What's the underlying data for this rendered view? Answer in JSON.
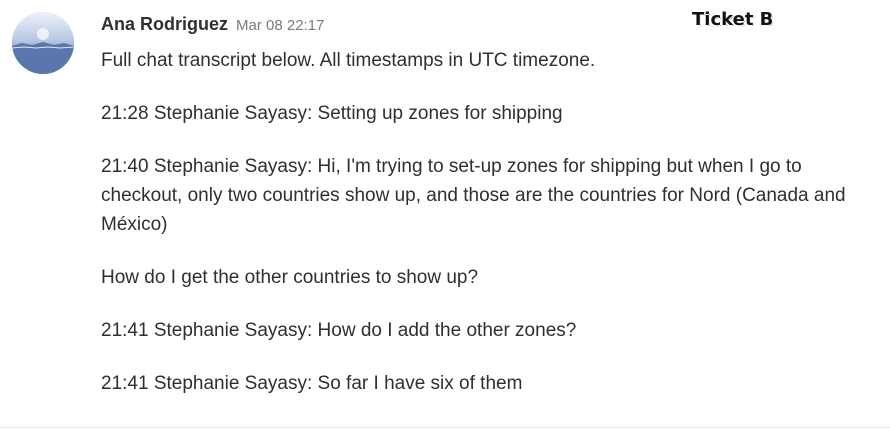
{
  "message": {
    "author": "Ana Rodriguez",
    "timestamp": "Mar 08 22:17",
    "lines": [
      "Full chat transcript below. All timestamps in UTC timezone.",
      "21:28 Stephanie Sayasy: Setting up zones for shipping",
      "21:40 Stephanie Sayasy: Hi, I'm trying to set-up zones for shipping but when I go to checkout, only two countries show up, and those are the countries for Nord (Canada and México)",
      "How do I get the other countries to show up?",
      "21:41 Stephanie Sayasy: How do I add the other zones?",
      "21:41 Stephanie Sayasy: So far I have six of them"
    ]
  },
  "overlay": {
    "ticket_label": "Ticket B"
  },
  "colors": {
    "author": "#303030",
    "timestamp": "#7b7b7b",
    "text": "#2f2f2f",
    "avatar": "#7f95bf"
  },
  "icons": {
    "avatar": "user-avatar-icon"
  }
}
